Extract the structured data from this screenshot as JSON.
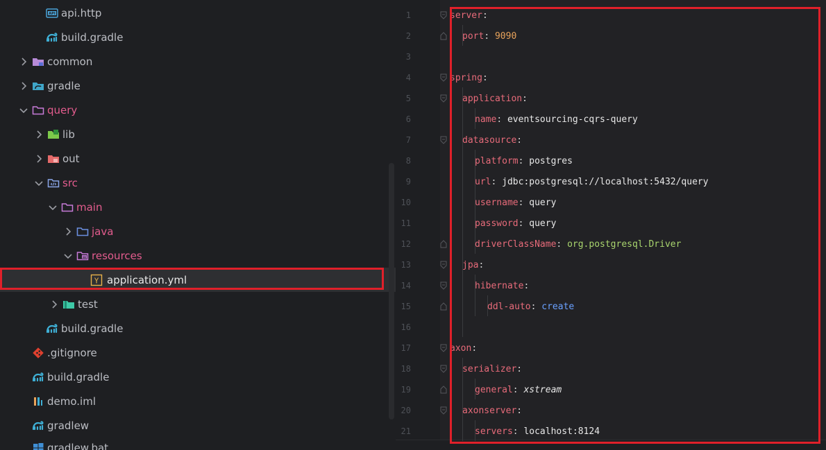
{
  "project_tree": {
    "items": [
      {
        "label": "api.http",
        "icon": "api-file-icon",
        "color": "plain"
      },
      {
        "label": "build.gradle",
        "icon": "gradle-icon",
        "color": "plain"
      },
      {
        "label": "common",
        "icon": "module-folder-icon",
        "color": "plain",
        "expanded": false
      },
      {
        "label": "gradle",
        "icon": "gradle-folder-icon",
        "color": "plain",
        "expanded": false
      },
      {
        "label": "query",
        "icon": "folder-icon",
        "color": "pink",
        "expanded": true
      },
      {
        "label": "lib",
        "icon": "library-folder-icon",
        "color": "plain",
        "expanded": false
      },
      {
        "label": "out",
        "icon": "output-folder-icon",
        "color": "plain",
        "expanded": false
      },
      {
        "label": "src",
        "icon": "source-folder-icon",
        "color": "pink",
        "expanded": true
      },
      {
        "label": "main",
        "icon": "folder-icon",
        "color": "pink",
        "expanded": true
      },
      {
        "label": "java",
        "icon": "java-folder-icon",
        "color": "pink",
        "expanded": false
      },
      {
        "label": "resources",
        "icon": "resources-folder-icon",
        "color": "pink",
        "expanded": true
      },
      {
        "label": "application.yml",
        "icon": "yaml-file-icon",
        "color": "white",
        "selected": true
      },
      {
        "label": "test",
        "icon": "test-folder-icon",
        "color": "plain",
        "expanded": false
      },
      {
        "label": "build.gradle",
        "icon": "gradle-icon",
        "color": "plain"
      },
      {
        "label": ".gitignore",
        "icon": "git-icon",
        "color": "plain"
      },
      {
        "label": "build.gradle",
        "icon": "gradle-icon",
        "color": "plain"
      },
      {
        "label": "demo.iml",
        "icon": "iml-file-icon",
        "color": "plain"
      },
      {
        "label": "gradlew",
        "icon": "gradle-icon",
        "color": "plain"
      },
      {
        "label": "gradlew.bat",
        "icon": "windows-icon",
        "color": "plain"
      }
    ]
  },
  "editor": {
    "lines": [
      {
        "n": "1",
        "key": "server",
        "sep": ":",
        "val": ""
      },
      {
        "n": "2",
        "key": "port",
        "sep": ": ",
        "val": "9090"
      },
      {
        "n": "3",
        "key": "",
        "sep": "",
        "val": ""
      },
      {
        "n": "4",
        "key": "spring",
        "sep": ":",
        "val": ""
      },
      {
        "n": "5",
        "key": "application",
        "sep": ":",
        "val": ""
      },
      {
        "n": "6",
        "key": "name",
        "sep": ": ",
        "val": "eventsourcing-cqrs-query"
      },
      {
        "n": "7",
        "key": "datasource",
        "sep": ":",
        "val": ""
      },
      {
        "n": "8",
        "key": "platform",
        "sep": ": ",
        "val": "postgres"
      },
      {
        "n": "9",
        "key": "url",
        "sep": ": ",
        "val": "jdbc:postgresql://localhost:5432/query"
      },
      {
        "n": "10",
        "key": "username",
        "sep": ": ",
        "val": "query"
      },
      {
        "n": "11",
        "key": "password",
        "sep": ": ",
        "val": "query"
      },
      {
        "n": "12",
        "key": "driverClassName",
        "sep": ": ",
        "val": "org.postgresql.Driver"
      },
      {
        "n": "13",
        "key": "jpa",
        "sep": ":",
        "val": ""
      },
      {
        "n": "14",
        "key": "hibernate",
        "sep": ":",
        "val": ""
      },
      {
        "n": "15",
        "key": "ddl-auto",
        "sep": ": ",
        "val": "create"
      },
      {
        "n": "16",
        "key": "",
        "sep": "",
        "val": ""
      },
      {
        "n": "17",
        "key": "axon",
        "sep": ":",
        "val": ""
      },
      {
        "n": "18",
        "key": "serializer",
        "sep": ":",
        "val": ""
      },
      {
        "n": "19",
        "key": "general",
        "sep": ": ",
        "val": "xstream"
      },
      {
        "n": "20",
        "key": "axonserver",
        "sep": ":",
        "val": ""
      },
      {
        "n": "21",
        "key": "servers",
        "sep": ": ",
        "val": "localhost:8124"
      }
    ]
  },
  "colors": {
    "highlight": "#e0202a",
    "key": "#e86b7a",
    "accent_pink": "#e35c8e"
  }
}
